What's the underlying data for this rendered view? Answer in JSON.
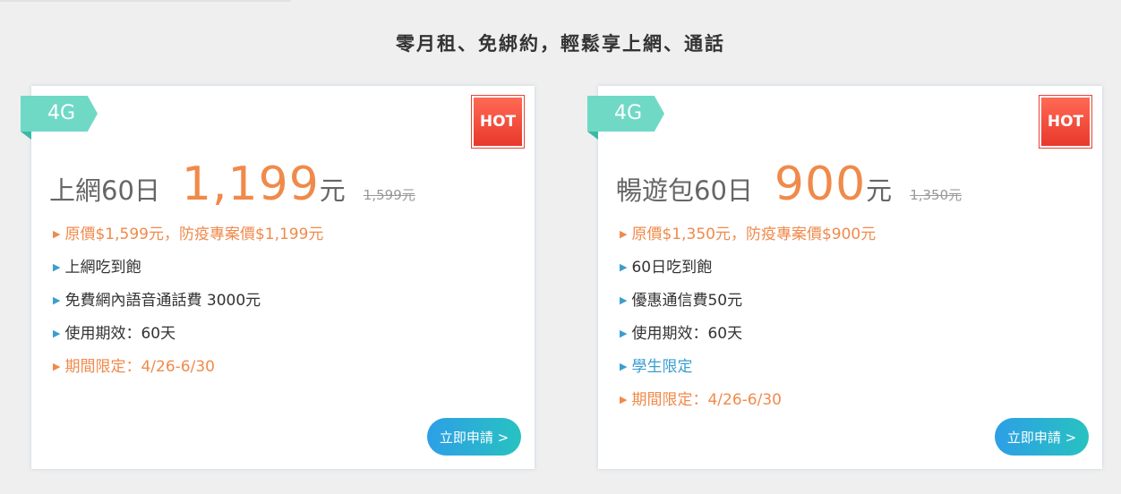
{
  "heading": "零月租、免綁約，輕鬆享上網、通話",
  "cards": [
    {
      "tag": "4G",
      "badge": "HOT",
      "plan_name": "上網60日",
      "price": "1,199",
      "unit": "元",
      "original_price": "1,599元",
      "features": [
        {
          "text": "原價$1,599元，防疫專案價$1,199元",
          "style": "orange"
        },
        {
          "text": "上網吃到飽",
          "style": "dark"
        },
        {
          "text": "免費網內語音通話費 3000元",
          "style": "dark"
        },
        {
          "text": "使用期效：60天",
          "style": "dark"
        },
        {
          "text": "期間限定：4/26-6/30",
          "style": "orange"
        }
      ],
      "button": "立即申請 >"
    },
    {
      "tag": "4G",
      "badge": "HOT",
      "plan_name": "暢遊包60日",
      "price": "900",
      "unit": "元",
      "original_price": "1,350元",
      "features": [
        {
          "text": "原價$1,350元，防疫專案價$900元",
          "style": "orange"
        },
        {
          "text": "60日吃到飽",
          "style": "dark"
        },
        {
          "text": "優惠通信費50元",
          "style": "dark"
        },
        {
          "text": "使用期效：60天",
          "style": "dark"
        },
        {
          "text": "學生限定",
          "style": "blue"
        },
        {
          "text": "期間限定：4/26-6/30",
          "style": "orange"
        }
      ],
      "button": "立即申請 >"
    }
  ],
  "bullet_glyph": "▶",
  "colors": {
    "accent_orange": "#f08a4b",
    "ribbon_teal": "#6fd9c6",
    "hot_red": "#e8382c",
    "link_blue": "#3a9ecf",
    "button_gradient_start": "#2d9fe6",
    "button_gradient_end": "#28c2c1"
  }
}
